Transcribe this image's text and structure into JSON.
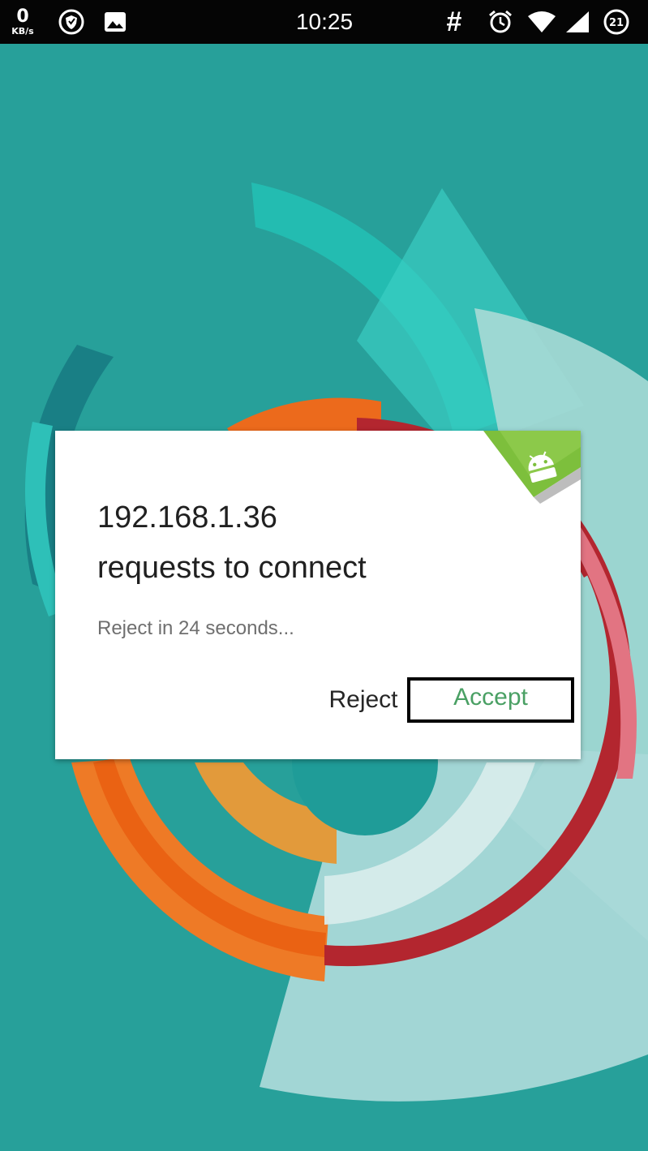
{
  "status_bar": {
    "net_speed_value": "0",
    "net_speed_unit": "KB/s",
    "time": "10:25",
    "hash_symbol": "#",
    "battery_level": "21",
    "icons": [
      "shield-icon",
      "image-icon",
      "alarm-icon",
      "wifi-icon",
      "signal-icon",
      "battery-icon"
    ]
  },
  "dialog": {
    "title": "192.168.1.36",
    "subtitle": "requests to connect",
    "countdown": "Reject in 24 seconds...",
    "reject_label": "Reject",
    "accept_label": "Accept",
    "badge_icon": "android-icon"
  },
  "colors": {
    "wallpaper_teal": "#27a09a",
    "accent_green": "#4aa064",
    "status_bar_bg": "#050505"
  }
}
